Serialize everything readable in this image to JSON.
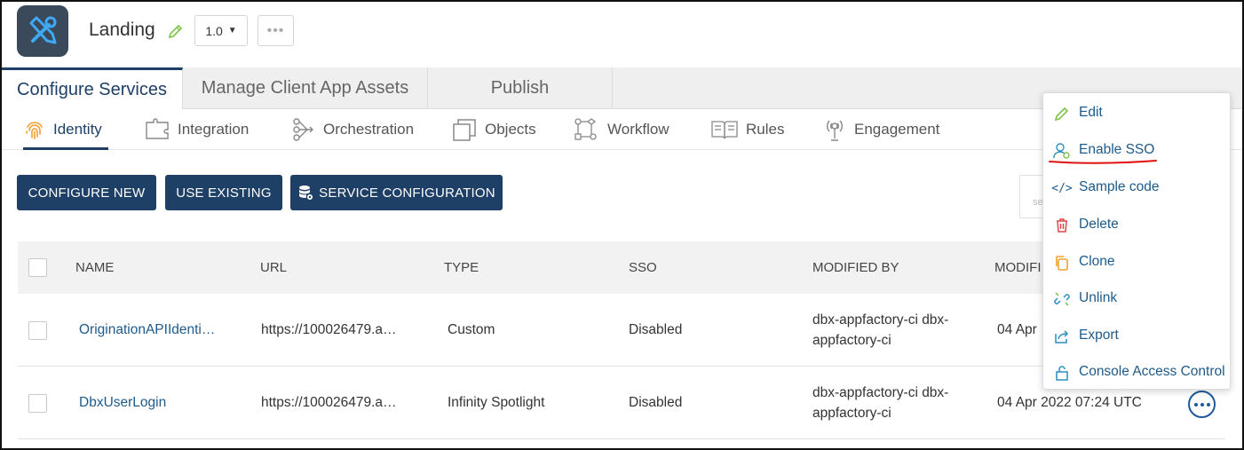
{
  "header": {
    "app_title": "Landing",
    "version": "1.0",
    "more_label": "•••"
  },
  "tabs": [
    {
      "label": "Configure Services",
      "active": true
    },
    {
      "label": "Manage Client App Assets",
      "active": false
    },
    {
      "label": "Publish",
      "active": false
    }
  ],
  "subtabs": [
    {
      "label": "Identity",
      "icon": "fingerprint-icon",
      "active": true
    },
    {
      "label": "Integration",
      "icon": "puzzle-icon"
    },
    {
      "label": "Orchestration",
      "icon": "orchestration-icon"
    },
    {
      "label": "Objects",
      "icon": "objects-icon"
    },
    {
      "label": "Workflow",
      "icon": "workflow-icon"
    },
    {
      "label": "Rules",
      "icon": "rules-book-icon"
    },
    {
      "label": "Engagement",
      "icon": "engagement-icon"
    }
  ],
  "actions": {
    "configure_new": "CONFIGURE NEW",
    "use_existing": "USE EXISTING",
    "service_configuration": "SERVICE CONFIGURATION",
    "search_placeholder": "se"
  },
  "table": {
    "columns": [
      "NAME",
      "URL",
      "TYPE",
      "SSO",
      "MODIFIED BY",
      "MODIFI"
    ],
    "rows": [
      {
        "name": "OriginationAPIIdenti…",
        "url": "https://100026479.a…",
        "type": "Custom",
        "sso": "Disabled",
        "modified_by_1": "dbx-appfactory-ci dbx-",
        "modified_by_2": "appfactory-ci",
        "modified_on": "04 Apr"
      },
      {
        "name": "DbxUserLogin",
        "url": "https://100026479.a…",
        "type": "Infinity Spotlight",
        "sso": "Disabled",
        "modified_by_1": "dbx-appfactory-ci dbx-",
        "modified_by_2": "appfactory-ci",
        "modified_on": "04 Apr 2022 07:24 UTC"
      }
    ]
  },
  "context_menu": {
    "items": [
      {
        "label": "Edit",
        "icon": "pencil-icon"
      },
      {
        "label": "Enable SSO",
        "icon": "sso-user-icon"
      },
      {
        "label": "Sample code",
        "icon": "code-icon"
      },
      {
        "label": "Delete",
        "icon": "trash-icon"
      },
      {
        "label": "Clone",
        "icon": "clone-icon"
      },
      {
        "label": "Unlink",
        "icon": "unlink-icon"
      },
      {
        "label": "Export",
        "icon": "export-icon"
      },
      {
        "label": "Console Access Control",
        "icon": "lock-icon"
      }
    ]
  },
  "colors": {
    "primary": "#1e3f66",
    "link": "#1e5a8a",
    "annotation_underline": "#e01010"
  }
}
